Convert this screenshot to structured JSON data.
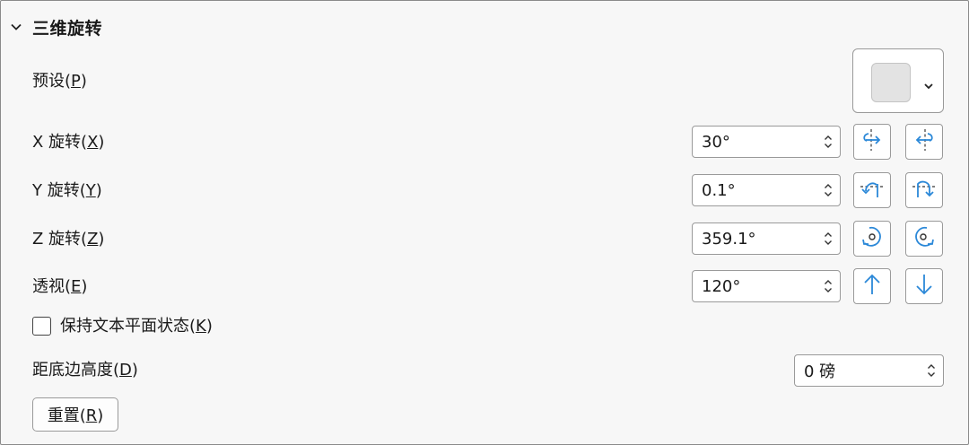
{
  "section": {
    "title": "三维旋转",
    "icon": "chevron-down-icon"
  },
  "preset": {
    "label_text": "预设(",
    "label_key": "P",
    "label_end": ")",
    "swatch_color": "#e3e3e3"
  },
  "x_rotation": {
    "label_text": "X 旋转(",
    "label_key": "X",
    "label_end": ")",
    "value": "30°",
    "btn_left_icon": "rotate-left-icon",
    "btn_right_icon": "rotate-right-icon"
  },
  "y_rotation": {
    "label_text": "Y 旋转(",
    "label_key": "Y",
    "label_end": ")",
    "value": "0.1°",
    "btn_up_icon": "rotate-up-icon",
    "btn_down_icon": "rotate-down-icon"
  },
  "z_rotation": {
    "label_text": "Z 旋转(",
    "label_key": "Z",
    "label_end": ")",
    "value": "359.1°",
    "btn_ccw_icon": "rotate-counterclockwise-icon",
    "btn_cw_icon": "rotate-clockwise-icon"
  },
  "perspective": {
    "label_text": "透视(",
    "label_key": "E",
    "label_end": ")",
    "value": "120°",
    "btn_increase_icon": "arrow-up-icon",
    "btn_decrease_icon": "arrow-down-icon"
  },
  "keep_text_flat": {
    "label_text": "保持文本平面状态(",
    "label_key": "K",
    "label_end": ")",
    "checked": false
  },
  "distance_from_ground": {
    "label_text": "距底边高度(",
    "label_key": "D",
    "label_end": ")",
    "value": "0 磅"
  },
  "reset": {
    "label_text": "重置(",
    "label_key": "R",
    "label_end": ")"
  },
  "colors": {
    "accent_icon": "#2b88d8",
    "border": "#9a9a9a",
    "background": "#f7f7f7"
  }
}
